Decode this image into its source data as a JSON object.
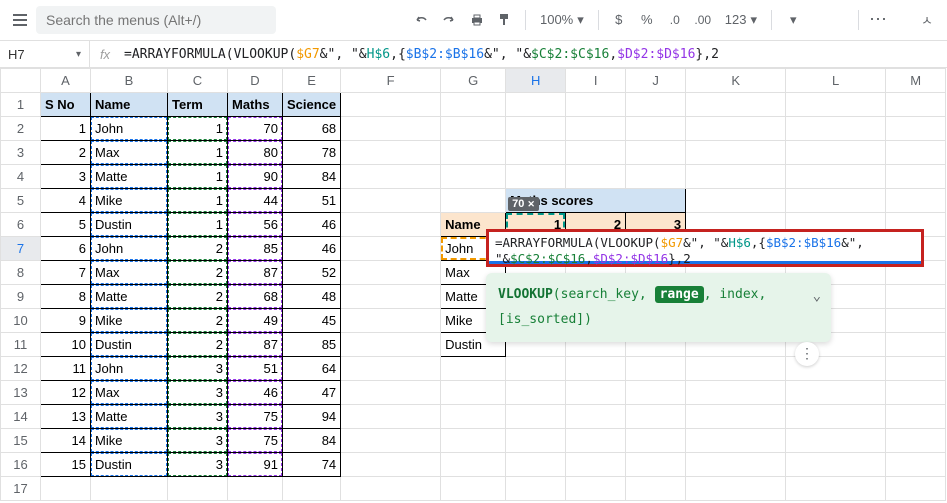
{
  "toolbar": {
    "search_placeholder": "Search the menus (Alt+/)",
    "zoom": "100%",
    "fmt123": "123"
  },
  "formula_bar": {
    "cell_ref": "H7",
    "fx_label": "fx",
    "formula_plain": "=ARRAYFORMULA(VLOOKUP($G7&\", \"&H$6,{$B$2:$B$16&\", \"&$C$2:$C$16,$D$2:$D$16},2"
  },
  "headers": {
    "sno": "S No",
    "name": "Name",
    "term": "Term",
    "maths": "Maths",
    "science": "Science"
  },
  "rows": [
    {
      "n": 1,
      "name": "John",
      "term": 1,
      "maths": 70,
      "science": 68
    },
    {
      "n": 2,
      "name": "Max",
      "term": 1,
      "maths": 80,
      "science": 78
    },
    {
      "n": 3,
      "name": "Matte",
      "term": 1,
      "maths": 90,
      "science": 84
    },
    {
      "n": 4,
      "name": "Mike",
      "term": 1,
      "maths": 44,
      "science": 51
    },
    {
      "n": 5,
      "name": "Dustin",
      "term": 1,
      "maths": 56,
      "science": 46
    },
    {
      "n": 6,
      "name": "John",
      "term": 2,
      "maths": 85,
      "science": 46
    },
    {
      "n": 7,
      "name": "Max",
      "term": 2,
      "maths": 87,
      "science": 52
    },
    {
      "n": 8,
      "name": "Matte",
      "term": 2,
      "maths": 68,
      "science": 48
    },
    {
      "n": 9,
      "name": "Mike",
      "term": 2,
      "maths": 49,
      "science": 45
    },
    {
      "n": 10,
      "name": "Dustin",
      "term": 2,
      "maths": 87,
      "science": 85
    },
    {
      "n": 11,
      "name": "John",
      "term": 3,
      "maths": 51,
      "science": 64
    },
    {
      "n": 12,
      "name": "Max",
      "term": 3,
      "maths": 46,
      "science": 47
    },
    {
      "n": 13,
      "name": "Matte",
      "term": 3,
      "maths": 75,
      "science": 94
    },
    {
      "n": 14,
      "name": "Mike",
      "term": 3,
      "maths": 75,
      "science": 84
    },
    {
      "n": 15,
      "name": "Dustin",
      "term": 3,
      "maths": 91,
      "science": 74
    }
  ],
  "lookup": {
    "title": "Maths scores",
    "name_hdr": "Name",
    "terms": [
      "1",
      "2",
      "3"
    ],
    "names": [
      "John",
      "Max",
      "Matte",
      "Mike",
      "Dustin"
    ],
    "result_preview": "70"
  },
  "overlay_formula": {
    "p1": "=ARRAYFORMULA(",
    "p2": "VLOOKUP(",
    "p3": "$G7",
    "p4": "&\", \"&",
    "p5": "H$6",
    "p6": ",{",
    "p7": "$B$2:$B$16",
    "p8": "&\", \"&",
    "p9": "$C$2:$C$16",
    "p10": ",",
    "p11": "$D$2:$D$16",
    "p12": "},",
    "p13": "2"
  },
  "hint": {
    "fn": "VLOOKUP",
    "args_open": "(",
    "a1": "search_key",
    "sep": ", ",
    "a2": "range",
    "a3": "index",
    "a4": "[is_sorted]",
    "args_close": ")"
  },
  "cols": [
    "",
    "A",
    "B",
    "C",
    "D",
    "E",
    "F",
    "G",
    "H",
    "I",
    "J",
    "K",
    "L",
    "M"
  ]
}
